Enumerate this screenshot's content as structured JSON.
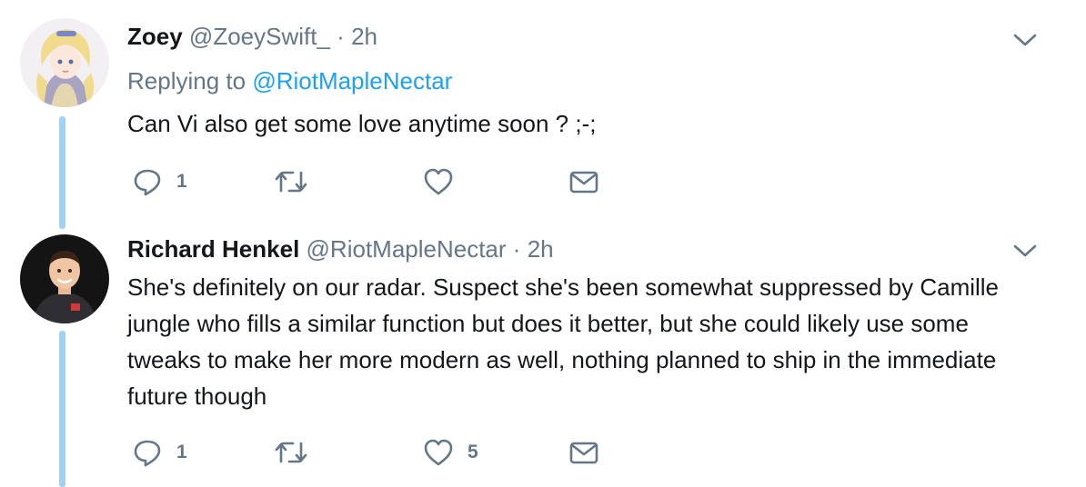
{
  "tweets": [
    {
      "name": "Zoey",
      "handle": "@ZoeySwift_",
      "separator": "·",
      "time": "2h",
      "replying_prefix": "Replying to",
      "replying_to": "@RiotMapleNectar",
      "text": "Can Vi also get some love anytime soon ? ;-;",
      "reply_count": "1",
      "retweet_count": "",
      "like_count": "",
      "icons": {
        "reply": "reply-icon",
        "retweet": "retweet-icon",
        "like": "heart-icon",
        "dm": "envelope-icon",
        "menu": "chevron-down-icon"
      }
    },
    {
      "name": "Richard Henkel",
      "handle": "@RiotMapleNectar",
      "separator": "·",
      "time": "2h",
      "text": "She's definitely on our radar. Suspect she's been somewhat suppressed by Camille jungle who fills a similar function but does it better, but she could likely use some tweaks to make her more modern as well, nothing planned to ship in the immediate future though",
      "reply_count": "1",
      "retweet_count": "",
      "like_count": "5",
      "icons": {
        "reply": "reply-icon",
        "retweet": "retweet-icon",
        "like": "heart-icon",
        "dm": "envelope-icon",
        "menu": "chevron-down-icon"
      }
    }
  ],
  "colors": {
    "text": "#14171a",
    "secondary": "#657786",
    "link": "#1da1f2",
    "thread_line": "#9fd3f5"
  }
}
